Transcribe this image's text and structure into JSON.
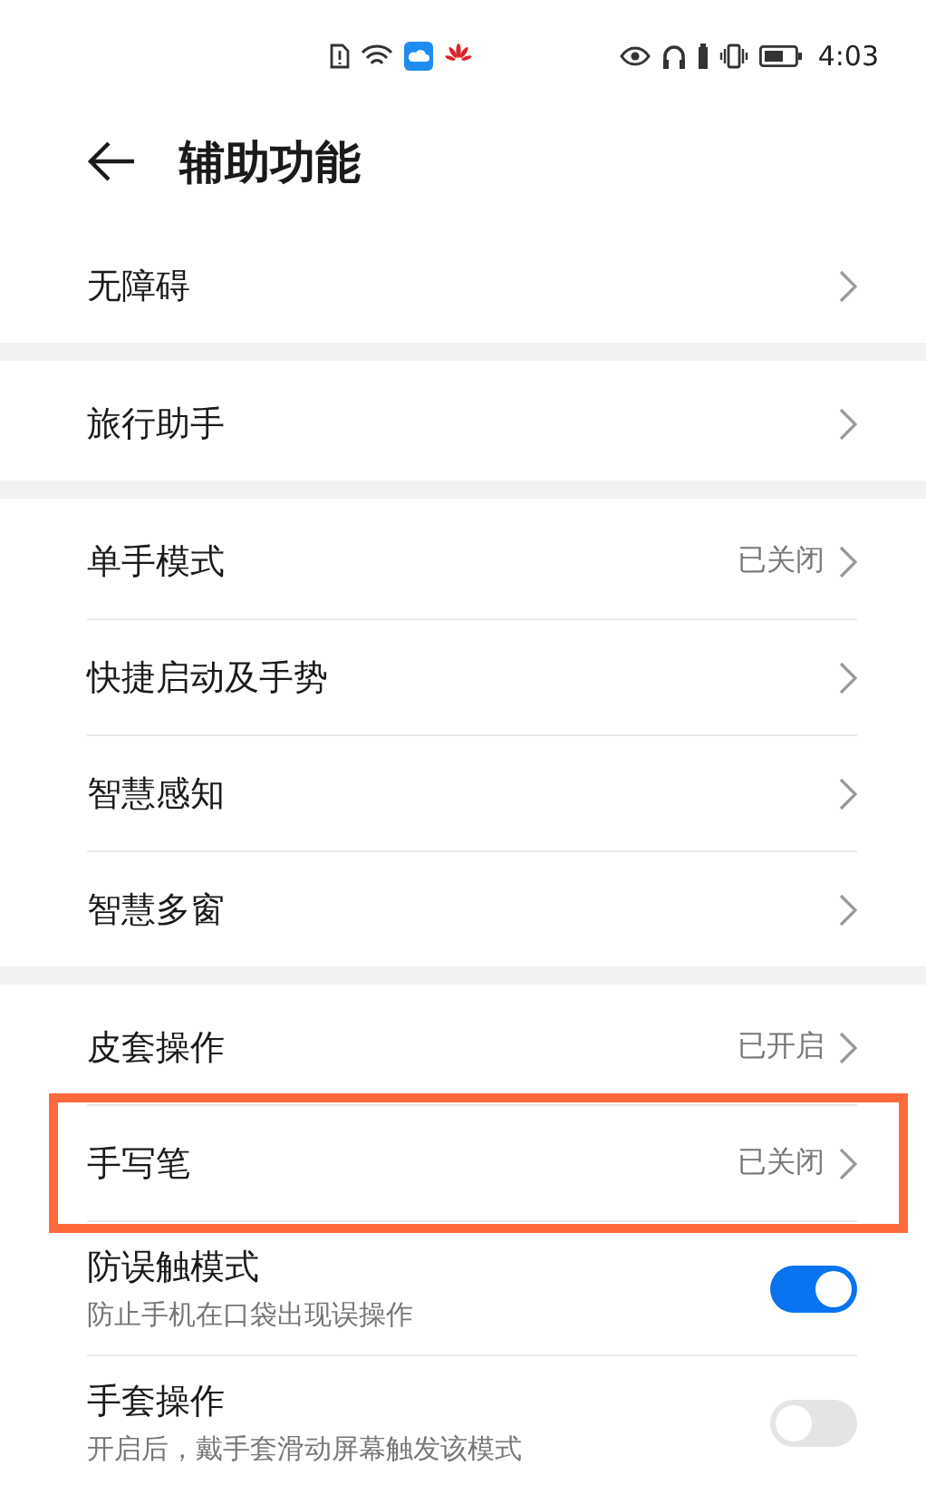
{
  "status_bar": {
    "time": "4:03"
  },
  "header": {
    "title": "辅助功能"
  },
  "groups": [
    {
      "items": [
        {
          "kind": "link",
          "label": "无障碍"
        }
      ]
    },
    {
      "items": [
        {
          "kind": "link",
          "label": "旅行助手"
        }
      ]
    },
    {
      "items": [
        {
          "kind": "link",
          "label": "单手模式",
          "value": "已关闭"
        },
        {
          "kind": "link",
          "label": "快捷启动及手势"
        },
        {
          "kind": "link",
          "label": "智慧感知"
        },
        {
          "kind": "link",
          "label": "智慧多窗"
        }
      ]
    },
    {
      "items": [
        {
          "kind": "link",
          "label": "皮套操作",
          "value": "已开启"
        },
        {
          "kind": "link",
          "label": "手写笔",
          "value": "已关闭",
          "highlighted": true
        },
        {
          "kind": "switch",
          "label": "防误触模式",
          "subtitle": "防止手机在口袋出现误操作",
          "on": true
        },
        {
          "kind": "switch",
          "label": "手套操作",
          "subtitle": "开启后，戴手套滑动屏幕触发该模式",
          "on": false
        }
      ]
    }
  ]
}
